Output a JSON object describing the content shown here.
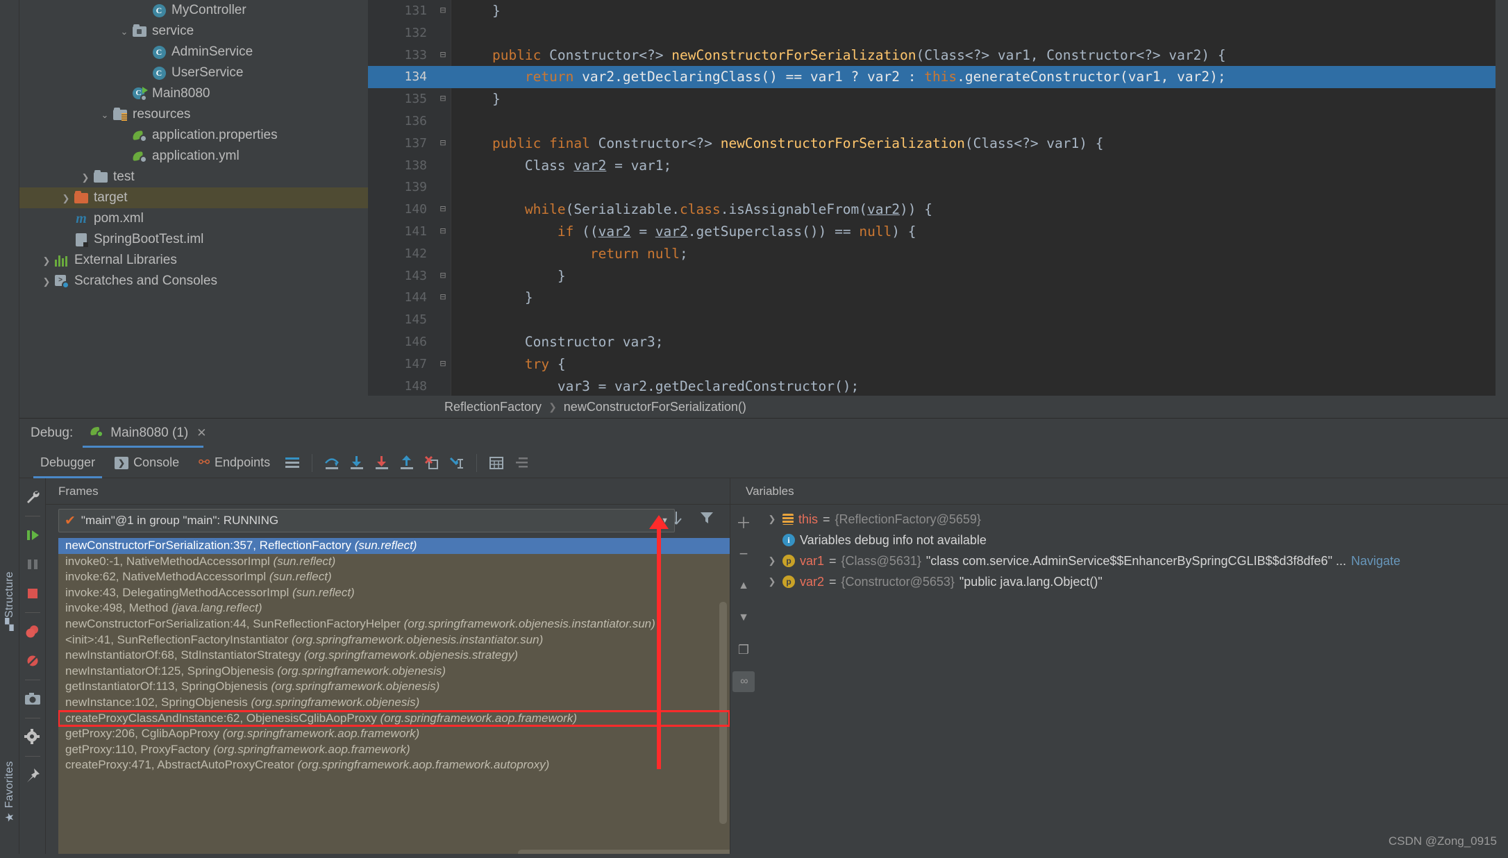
{
  "vertical_tools": [
    {
      "label": "Structure",
      "icon": "structure-icon"
    },
    {
      "label": "Favorites",
      "icon": "star-icon"
    }
  ],
  "project_tree": [
    {
      "label": "MyController",
      "icon": "java-class-icon",
      "indent": 5,
      "arrow": "",
      "selected": false
    },
    {
      "label": "service",
      "icon": "package-folder-icon",
      "indent": 4,
      "arrow": "v",
      "selected": false
    },
    {
      "label": "AdminService",
      "icon": "java-class-icon",
      "indent": 5,
      "arrow": "",
      "selected": false
    },
    {
      "label": "UserService",
      "icon": "java-class-icon",
      "indent": 5,
      "arrow": "",
      "selected": false
    },
    {
      "label": "Main8080",
      "icon": "spring-main-class-icon",
      "indent": 4,
      "arrow": "",
      "selected": false
    },
    {
      "label": "resources",
      "icon": "resources-folder-icon",
      "indent": 3,
      "arrow": "v",
      "selected": false
    },
    {
      "label": "application.properties",
      "icon": "spring-config-icon",
      "indent": 4,
      "arrow": "",
      "selected": false
    },
    {
      "label": "application.yml",
      "icon": "spring-config-icon",
      "indent": 4,
      "arrow": "",
      "selected": false
    },
    {
      "label": "test",
      "icon": "folder-icon",
      "indent": 2,
      "arrow": ">",
      "selected": false
    },
    {
      "label": "target",
      "icon": "target-folder-icon",
      "indent": 1,
      "arrow": ">",
      "selected": true
    },
    {
      "label": "pom.xml",
      "icon": "maven-icon",
      "indent": 1,
      "arrow": "",
      "selected": false
    },
    {
      "label": "SpringBootTest.iml",
      "icon": "iml-file-icon",
      "indent": 1,
      "arrow": "",
      "selected": false
    },
    {
      "label": "External Libraries",
      "icon": "library-icon",
      "indent": 0,
      "arrow": ">",
      "selected": false
    },
    {
      "label": "Scratches and Consoles",
      "icon": "scratches-icon",
      "indent": 0,
      "arrow": ">",
      "selected": false
    }
  ],
  "editor": {
    "lines": [
      {
        "num": "131",
        "fold": "-",
        "current": false,
        "html": "    }"
      },
      {
        "num": "132",
        "fold": "",
        "current": false,
        "html": ""
      },
      {
        "num": "133",
        "fold": "-",
        "current": false,
        "html": "    <span class='kw'>public</span> Constructor&lt;?&gt; <span class='fn'>newConstructorForSerialization</span>(Class&lt;?&gt; var1, Constructor&lt;?&gt; var2) {"
      },
      {
        "num": "134",
        "fold": "",
        "current": true,
        "html": "        <span class='kw'>return</span> var2.getDeclaringClass() == var1 ? var2 : <span class='kw'>this</span>.generateConstructor(var1, var2);"
      },
      {
        "num": "135",
        "fold": "-",
        "current": false,
        "html": "    }"
      },
      {
        "num": "136",
        "fold": "",
        "current": false,
        "html": ""
      },
      {
        "num": "137",
        "fold": "-",
        "current": false,
        "html": "    <span class='kw'>public final</span> Constructor&lt;?&gt; <span class='fn'>newConstructorForSerialization</span>(Class&lt;?&gt; var1) {"
      },
      {
        "num": "138",
        "fold": "",
        "current": false,
        "html": "        Class <span class='var-u'>var2</span> = var1;"
      },
      {
        "num": "139",
        "fold": "",
        "current": false,
        "html": ""
      },
      {
        "num": "140",
        "fold": "-",
        "current": false,
        "html": "        <span class='kw'>while</span>(Serializable.<span class='kw'>class</span>.isAssignableFrom(<span class='var-u'>var2</span>)) {"
      },
      {
        "num": "141",
        "fold": "-",
        "current": false,
        "html": "            <span class='kw'>if</span> ((<span class='var-u'>var2</span> = <span class='var-u'>var2</span>.getSuperclass()) == <span class='kw'>null</span>) {"
      },
      {
        "num": "142",
        "fold": "",
        "current": false,
        "html": "                <span class='kw'>return null</span>;"
      },
      {
        "num": "143",
        "fold": "-",
        "current": false,
        "html": "            }"
      },
      {
        "num": "144",
        "fold": "-",
        "current": false,
        "html": "        }"
      },
      {
        "num": "145",
        "fold": "",
        "current": false,
        "html": ""
      },
      {
        "num": "146",
        "fold": "",
        "current": false,
        "html": "        Constructor var3;"
      },
      {
        "num": "147",
        "fold": "-",
        "current": false,
        "html": "        <span class='kw'>try</span> {"
      },
      {
        "num": "148",
        "fold": "",
        "current": false,
        "html": "            var3 = var2.getDeclaredConstructor();"
      }
    ],
    "breadcrumb": [
      "ReflectionFactory",
      "newConstructorForSerialization()"
    ]
  },
  "debug": {
    "label": "Debug:",
    "session_tab": "Main8080 (1)",
    "tabs": [
      {
        "label": "Debugger",
        "icon": "debugger-icon",
        "active": true
      },
      {
        "label": "Console",
        "icon": "console-icon",
        "active": false
      },
      {
        "label": "Endpoints",
        "icon": "endpoints-icon",
        "active": false
      }
    ],
    "toolbar_icons": [
      "layout-settings-icon",
      "step-over-icon",
      "step-into-icon",
      "force-step-into-icon",
      "step-out-icon",
      "drop-frame-icon",
      "run-to-cursor-icon",
      "evaluate-expression-icon",
      "mute-breakpoints-icon"
    ],
    "rail_icons": [
      "settings-wrench-icon",
      "resume-program-icon",
      "pause-program-icon",
      "stop-icon",
      "view-breakpoints-icon",
      "mute-breakpoints-icon",
      "snapshot-icon",
      "settings-gear-icon",
      "pin-tab-icon"
    ]
  },
  "frames": {
    "title": "Frames",
    "thread": "\"main\"@1 in group \"main\": RUNNING",
    "thread_status_icon": "check-icon",
    "toolbar_icons": [
      "arrow-up-icon",
      "arrow-down-icon",
      "filter-icon"
    ],
    "items": [
      {
        "method": "newConstructorForSerialization:357, ReflectionFactory",
        "pkg": "(sun.reflect)",
        "selected": true,
        "boxed": false
      },
      {
        "method": "invoke0:-1, NativeMethodAccessorImpl",
        "pkg": "(sun.reflect)",
        "selected": false,
        "boxed": false
      },
      {
        "method": "invoke:62, NativeMethodAccessorImpl",
        "pkg": "(sun.reflect)",
        "selected": false,
        "boxed": false
      },
      {
        "method": "invoke:43, DelegatingMethodAccessorImpl",
        "pkg": "(sun.reflect)",
        "selected": false,
        "boxed": false
      },
      {
        "method": "invoke:498, Method",
        "pkg": "(java.lang.reflect)",
        "selected": false,
        "boxed": false
      },
      {
        "method": "newConstructorForSerialization:44, SunReflectionFactoryHelper",
        "pkg": "(org.springframework.objenesis.instantiator.sun)",
        "selected": false,
        "boxed": false
      },
      {
        "method": "<init>:41, SunReflectionFactoryInstantiator",
        "pkg": "(org.springframework.objenesis.instantiator.sun)",
        "selected": false,
        "boxed": false
      },
      {
        "method": "newInstantiatorOf:68, StdInstantiatorStrategy",
        "pkg": "(org.springframework.objenesis.strategy)",
        "selected": false,
        "boxed": false
      },
      {
        "method": "newInstantiatorOf:125, SpringObjenesis",
        "pkg": "(org.springframework.objenesis)",
        "selected": false,
        "boxed": false
      },
      {
        "method": "getInstantiatorOf:113, SpringObjenesis",
        "pkg": "(org.springframework.objenesis)",
        "selected": false,
        "boxed": false
      },
      {
        "method": "newInstance:102, SpringObjenesis",
        "pkg": "(org.springframework.objenesis)",
        "selected": false,
        "boxed": false
      },
      {
        "method": "createProxyClassAndInstance:62, ObjenesisCglibAopProxy",
        "pkg": "(org.springframework.aop.framework)",
        "selected": false,
        "boxed": true
      },
      {
        "method": "getProxy:206, CglibAopProxy",
        "pkg": "(org.springframework.aop.framework)",
        "selected": false,
        "boxed": false
      },
      {
        "method": "getProxy:110, ProxyFactory",
        "pkg": "(org.springframework.aop.framework)",
        "selected": false,
        "boxed": false
      },
      {
        "method": "createProxy:471, AbstractAutoProxyCreator",
        "pkg": "(org.springframework.aop.framework.autoproxy)",
        "selected": false,
        "boxed": false
      }
    ]
  },
  "variables": {
    "title": "Variables",
    "rail_icons": [
      "add-icon",
      "remove-icon",
      "move-up-icon",
      "move-down-icon",
      "copy-icon",
      "inspect-icon"
    ],
    "rows": [
      {
        "twisty": ">",
        "icon": "field-icon",
        "name": "this",
        "eq": "=",
        "type": "{ReflectionFactory@5659}",
        "value": "",
        "link": ""
      },
      {
        "twisty": "",
        "icon": "info-icon",
        "name": "",
        "eq": "",
        "type": "",
        "value": "Variables debug info not available",
        "link": ""
      },
      {
        "twisty": ">",
        "icon": "param-icon",
        "name": "var1",
        "eq": "=",
        "type": "{Class@5631}",
        "value": "\"class com.service.AdminService$$EnhancerBySpringCGLIB$$d3f8dfe6\" ...",
        "link": "Navigate"
      },
      {
        "twisty": ">",
        "icon": "param-icon",
        "name": "var2",
        "eq": "=",
        "type": "{Constructor@5653}",
        "value": "\"public java.lang.Object()\"",
        "link": ""
      }
    ]
  },
  "watermark": "CSDN @Zong_0915",
  "colors": {
    "accent_blue": "#4a88c7",
    "selection_blue": "#2f6ea5",
    "frame_selected": "#4a78b5",
    "frames_bg": "#5b5648",
    "annotation_red": "#ff2b2b",
    "tree_selected": "#4f4b33",
    "editor_bg": "#2b2b2b",
    "panel_bg": "#3c3f41"
  }
}
